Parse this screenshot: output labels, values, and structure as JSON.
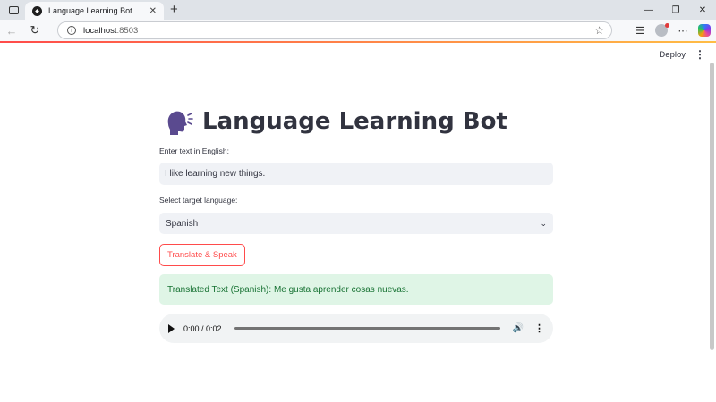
{
  "browser": {
    "tab_title": "Language Learning Bot",
    "url_host": "localhost",
    "url_port": ":8503"
  },
  "app": {
    "deploy_label": "Deploy",
    "title": "Language Learning Bot",
    "title_icon": "speaking-head-icon",
    "input_label": "Enter text in English:",
    "input_value": "I like learning new things.",
    "select_label": "Select target language:",
    "select_value": "Spanish",
    "button_label": "Translate & Speak",
    "result_text": "Translated Text (Spanish): Me gusta aprender cosas nuevas.",
    "audio_time": "0:00 / 0:02"
  },
  "colors": {
    "accent": "#ff4b4b",
    "success_bg": "#dff5e6",
    "success_text": "#177233"
  }
}
